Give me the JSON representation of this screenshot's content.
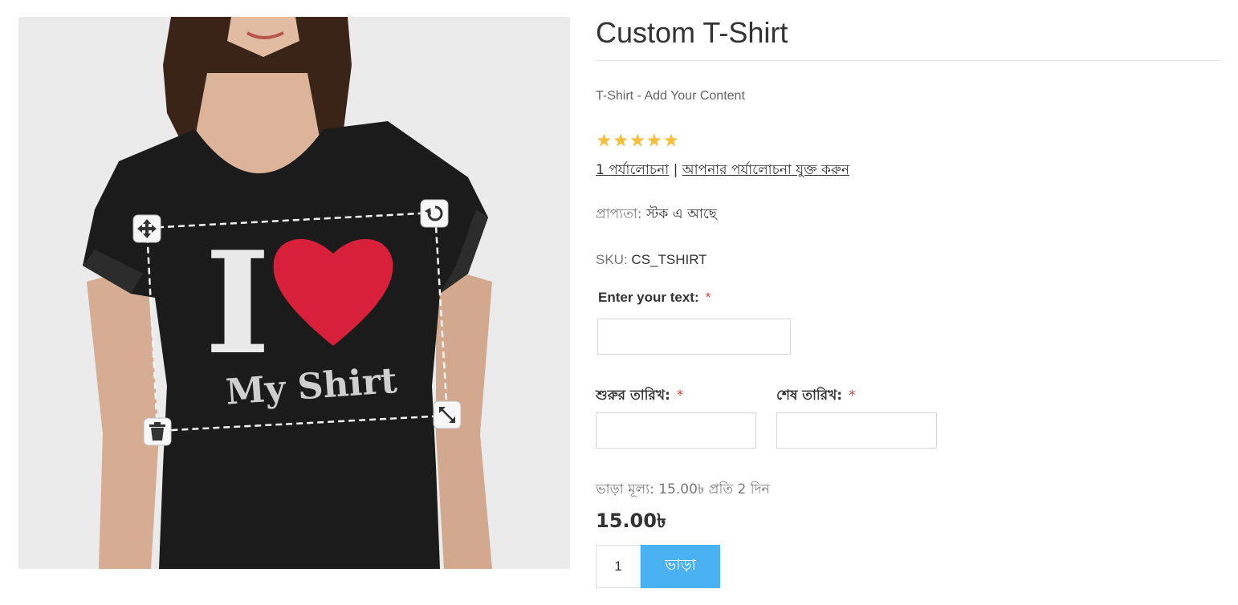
{
  "product": {
    "title": "Custom T-Shirt",
    "short_description": "T-Shirt - Add Your Content",
    "rating": 5,
    "rating_max": 5,
    "star_icon": "star-icon",
    "reviews_link": "1 পর্যালোচনা",
    "reviews_separator": " | ",
    "add_review_link": "আপনার পর্যালোচনা যুক্ত করুন",
    "availability_label": "প্রাপ্যতা:",
    "availability_value": "স্টক এ আছে",
    "sku_label": "SKU:",
    "sku_value": "CS_TSHIRT"
  },
  "image": {
    "print_big_letter": "I",
    "print_text": "My Shirt",
    "heart_color": "#d8203a",
    "shirt_color": "#1b1b1b",
    "tools": [
      "move-icon",
      "rotate-icon",
      "delete-icon",
      "resize-icon"
    ]
  },
  "form": {
    "text_label": "Enter your text:",
    "text_value": "",
    "required_mark": "*",
    "start_date_label": "শুরুর তারিখ:",
    "start_date_value": "",
    "end_date_label": "শেষ তারিখ:",
    "end_date_value": ""
  },
  "pricing": {
    "rent_info": "ভাড়া মূল্য: 15.00৳ প্রতি 2 দিন",
    "price": "15.00৳"
  },
  "cart": {
    "quantity": "1",
    "rent_button": "ভাড়া",
    "button_color": "#4ab2f1"
  }
}
